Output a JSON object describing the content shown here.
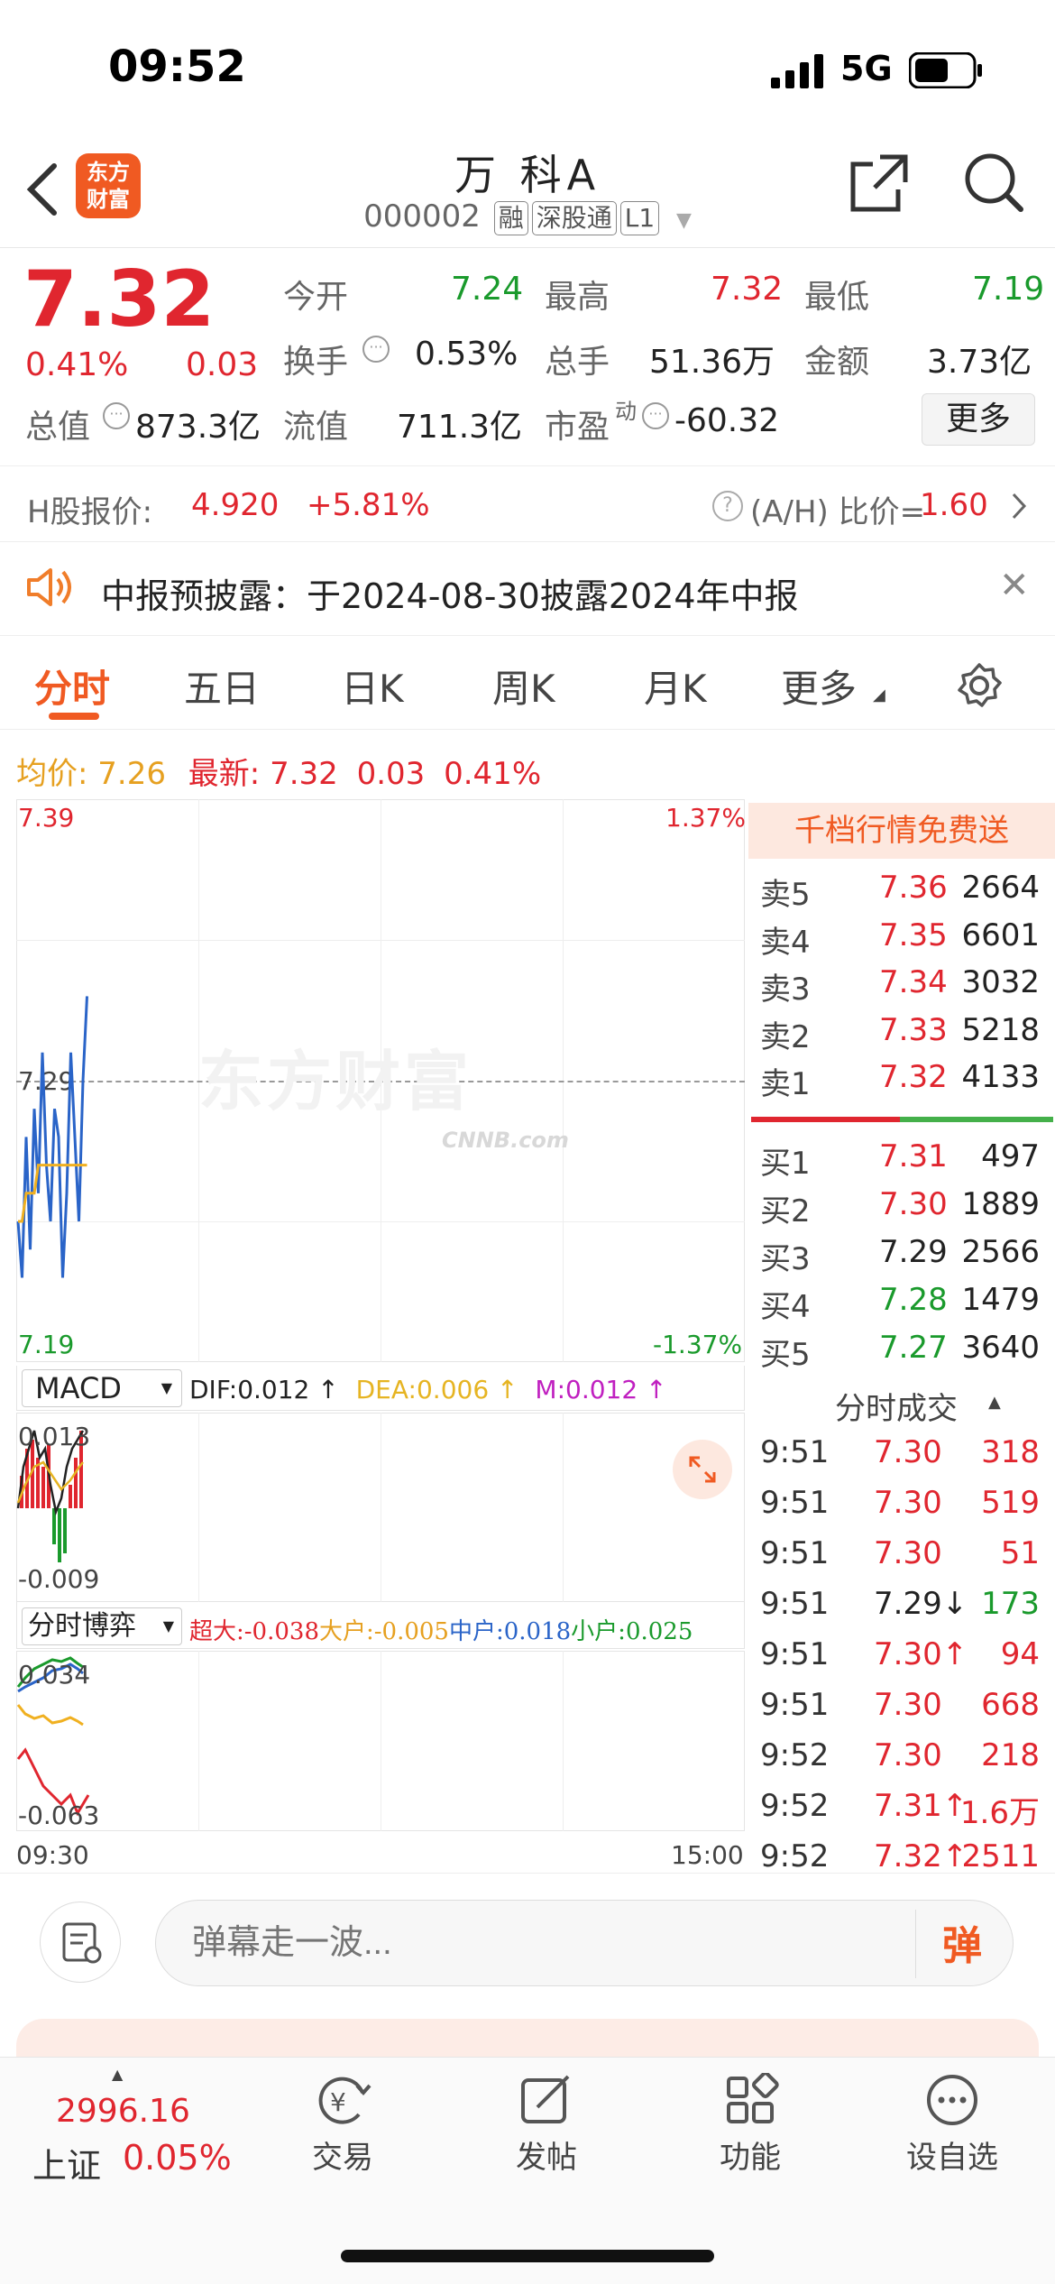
{
  "status_bar": {
    "time": "09:52",
    "network": "5G"
  },
  "header": {
    "title": "万 科A",
    "code": "000002",
    "tags": [
      "融",
      "深股通",
      "L1"
    ],
    "logo_text": "东方\n财富"
  },
  "quote": {
    "price": "7.32",
    "change_pct": "0.41%",
    "change": "0.03",
    "fields": [
      {
        "label": "今开",
        "value": "7.24",
        "color": "green"
      },
      {
        "label": "最高",
        "value": "7.32",
        "color": "red"
      },
      {
        "label": "最低",
        "value": "7.19",
        "color": "green"
      },
      {
        "label": "换手",
        "value": "0.53%",
        "color": "black"
      },
      {
        "label": "总手",
        "value": "51.36万",
        "color": "black"
      },
      {
        "label": "金额",
        "value": "3.73亿",
        "color": "black"
      },
      {
        "label": "总值",
        "value": "873.3亿",
        "color": "black"
      },
      {
        "label": "流值",
        "value": "711.3亿",
        "color": "black"
      },
      {
        "label": "市盈",
        "value": "-60.32",
        "color": "black"
      }
    ],
    "pe_sup": "动",
    "more_label": "更多"
  },
  "hshare": {
    "label": "H股报价:",
    "price": "4.920",
    "change": "+5.81%",
    "ratio_label": "(A/H) 比价=",
    "ratio_value": "1.60"
  },
  "notice": {
    "text": "中报预披露：于2024-08-30披露2024年中报"
  },
  "tabs": [
    "分时",
    "五日",
    "日K",
    "周K",
    "月K",
    "更多"
  ],
  "active_tab": "分时",
  "intraday": {
    "avg_label": "均价:",
    "avg_value": "7.26",
    "latest_label": "最新:",
    "latest_value": "7.32",
    "change": "0.03",
    "change_pct": "0.41%",
    "y_top": "7.39",
    "y_mid": "7.29",
    "y_bottom": "7.19",
    "pct_top": "1.37%",
    "pct_bottom": "-1.37%",
    "x_start": "09:30",
    "x_end": "15:00",
    "watermark1": "东方财富",
    "watermark2": "CNNB.com",
    "price_series": [
      7.24,
      7.22,
      7.27,
      7.23,
      7.28,
      7.25,
      7.3,
      7.26,
      7.24,
      7.28,
      7.27,
      7.22,
      7.25,
      7.3,
      7.27,
      7.24,
      7.29,
      7.32
    ],
    "avg_series": [
      7.24,
      7.24,
      7.25,
      7.25,
      7.25,
      7.26,
      7.26,
      7.26,
      7.26,
      7.26,
      7.26,
      7.26,
      7.26,
      7.26,
      7.26,
      7.26,
      7.26,
      7.26
    ]
  },
  "macd": {
    "name": "MACD",
    "dif_label": "DIF:",
    "dif": "0.012 ↑",
    "dea_label": "DEA:",
    "dea": "0.006 ↑",
    "m_label": "M:",
    "m": "0.012 ↑",
    "y_top": "0.013",
    "y_bottom": "-0.009",
    "colors": {
      "dif": "#222222",
      "dea": "#e6b422",
      "m": "#c020c0"
    }
  },
  "capital": {
    "name": "分时博弈",
    "super_label": "超大:",
    "super": "-0.038",
    "big_label": "大户:",
    "big": "-0.005",
    "mid_label": "中户:",
    "mid": "0.018",
    "small_label": "小户:",
    "small": "0.025",
    "y_top": "0.034",
    "y_bottom": "-0.063"
  },
  "orderbook": {
    "promo": "千档行情免费送",
    "asks": [
      {
        "label": "卖5",
        "price": "7.36",
        "vol": "2664"
      },
      {
        "label": "卖4",
        "price": "7.35",
        "vol": "6601"
      },
      {
        "label": "卖3",
        "price": "7.34",
        "vol": "3032"
      },
      {
        "label": "卖2",
        "price": "7.33",
        "vol": "5218"
      },
      {
        "label": "卖1",
        "price": "7.32",
        "vol": "4133"
      }
    ],
    "bids": [
      {
        "label": "买1",
        "price": "7.31",
        "vol": "497"
      },
      {
        "label": "买2",
        "price": "7.30",
        "vol": "1889"
      },
      {
        "label": "买3",
        "price": "7.29",
        "vol": "2566"
      },
      {
        "label": "买4",
        "price": "7.28",
        "vol": "1479"
      },
      {
        "label": "买5",
        "price": "7.27",
        "vol": "3640"
      }
    ],
    "bid_price_colors": [
      "red",
      "red",
      "black",
      "green",
      "green"
    ]
  },
  "trades": {
    "title": "分时成交",
    "rows": [
      {
        "time": "9:51",
        "price": "7.30",
        "vol": "318",
        "pc": "red",
        "vc": "red"
      },
      {
        "time": "9:51",
        "price": "7.30",
        "vol": "519",
        "pc": "red",
        "vc": "red"
      },
      {
        "time": "9:51",
        "price": "7.30",
        "vol": "51",
        "pc": "red",
        "vc": "red"
      },
      {
        "time": "9:51",
        "price": "7.29↓",
        "vol": "173",
        "pc": "black",
        "vc": "green"
      },
      {
        "time": "9:51",
        "price": "7.30↑",
        "vol": "94",
        "pc": "red",
        "vc": "red"
      },
      {
        "time": "9:51",
        "price": "7.30",
        "vol": "668",
        "pc": "red",
        "vc": "red"
      },
      {
        "time": "9:52",
        "price": "7.30",
        "vol": "218",
        "pc": "red",
        "vc": "red"
      },
      {
        "time": "9:52",
        "price": "7.31↑",
        "vol": "1.6万",
        "pc": "red",
        "vc": "red"
      },
      {
        "time": "9:52",
        "price": "7.32↑",
        "vol": "2511",
        "pc": "red",
        "vc": "red"
      }
    ]
  },
  "danmaku": {
    "placeholder": "弹幕走一波...",
    "send": "弹"
  },
  "bottom": {
    "index_value": "2996.16",
    "index_name": "上证",
    "index_pct": "0.05%",
    "items": [
      {
        "label": "交易"
      },
      {
        "label": "发帖"
      },
      {
        "label": "功能"
      },
      {
        "label": "设自选"
      }
    ]
  }
}
